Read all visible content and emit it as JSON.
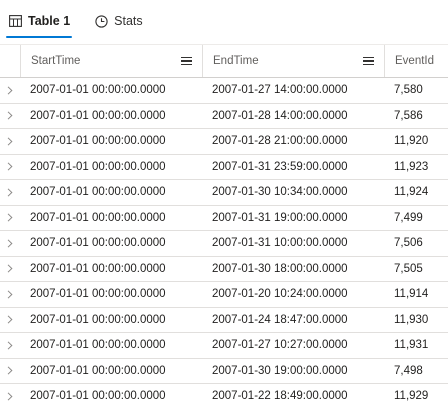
{
  "tabs": [
    {
      "label": "Table 1",
      "icon": "table-icon",
      "active": true
    },
    {
      "label": "Stats",
      "icon": "stats-icon",
      "active": false
    }
  ],
  "columns": [
    "StartTime",
    "EndTime",
    "EventId"
  ],
  "rows": [
    {
      "start": "2007-01-01 00:00:00.0000",
      "end": "2007-01-27 14:00:00.0000",
      "event": "7,580"
    },
    {
      "start": "2007-01-01 00:00:00.0000",
      "end": "2007-01-28 14:00:00.0000",
      "event": "7,586"
    },
    {
      "start": "2007-01-01 00:00:00.0000",
      "end": "2007-01-28 21:00:00.0000",
      "event": "11,920"
    },
    {
      "start": "2007-01-01 00:00:00.0000",
      "end": "2007-01-31 23:59:00.0000",
      "event": "11,923"
    },
    {
      "start": "2007-01-01 00:00:00.0000",
      "end": "2007-01-30 10:34:00.0000",
      "event": "11,924"
    },
    {
      "start": "2007-01-01 00:00:00.0000",
      "end": "2007-01-31 19:00:00.0000",
      "event": "7,499"
    },
    {
      "start": "2007-01-01 00:00:00.0000",
      "end": "2007-01-31 10:00:00.0000",
      "event": "7,506"
    },
    {
      "start": "2007-01-01 00:00:00.0000",
      "end": "2007-01-30 18:00:00.0000",
      "event": "7,505"
    },
    {
      "start": "2007-01-01 00:00:00.0000",
      "end": "2007-01-20 10:24:00.0000",
      "event": "11,914"
    },
    {
      "start": "2007-01-01 00:00:00.0000",
      "end": "2007-01-24 18:47:00.0000",
      "event": "11,930"
    },
    {
      "start": "2007-01-01 00:00:00.0000",
      "end": "2007-01-27 10:27:00.0000",
      "event": "11,931"
    },
    {
      "start": "2007-01-01 00:00:00.0000",
      "end": "2007-01-30 19:00:00.0000",
      "event": "7,498"
    },
    {
      "start": "2007-01-01 00:00:00.0000",
      "end": "2007-01-22 18:49:00.0000",
      "event": "11,929"
    }
  ],
  "colors": {
    "accent": "#0078d4",
    "grid_line": "#e1dfdd",
    "header_text": "#605e5c"
  }
}
